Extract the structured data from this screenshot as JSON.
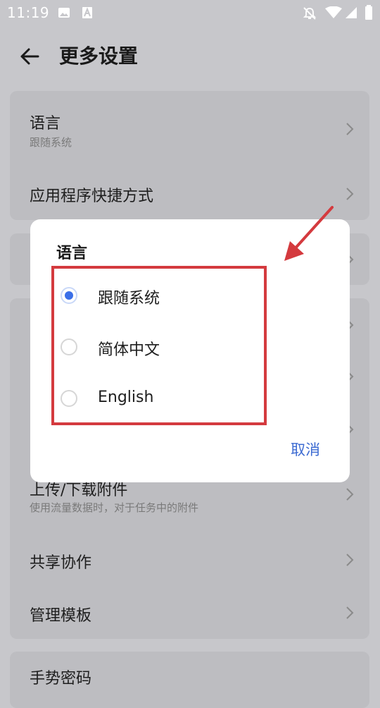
{
  "status_bar": {
    "time": "11:19",
    "icons": [
      "image-icon",
      "a-icon",
      "notifications-off-icon",
      "wifi-icon",
      "cell-signal-icon",
      "battery-icon"
    ]
  },
  "header": {
    "title": "更多设置",
    "back_icon": "arrow-left-icon"
  },
  "settings": {
    "language": {
      "label": "语言",
      "value": "跟随系统"
    },
    "shortcuts": {
      "label": "应用程序快捷方式"
    },
    "partial_rows": [
      "…",
      "…",
      "…",
      "…"
    ],
    "upload": {
      "label": "上传/下载附件",
      "sub": "使用流量数据时，对于任务中的附件"
    },
    "share": {
      "label": "共享协作"
    },
    "templates": {
      "label": "管理模板"
    },
    "gesture": {
      "label": "手势密码"
    }
  },
  "dialog": {
    "title": "语言",
    "options": [
      {
        "label": "跟随系统",
        "selected": true
      },
      {
        "label": "简体中文",
        "selected": false
      },
      {
        "label": "English",
        "selected": false
      }
    ],
    "cancel_label": "取消"
  },
  "colors": {
    "accent": "#3b6fe8",
    "annotation": "#d43a3e",
    "dim_background": "#c7c7cb"
  }
}
